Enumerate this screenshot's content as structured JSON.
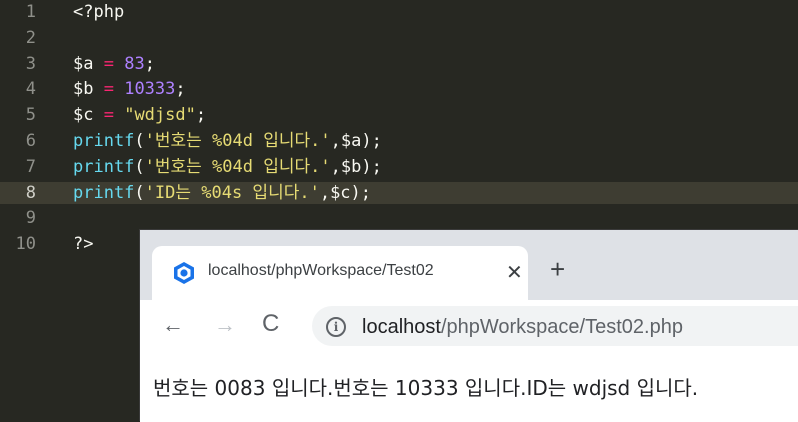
{
  "editor": {
    "lines": [
      {
        "num": "1",
        "parts": [
          {
            "t": "<?php",
            "c": "plain"
          }
        ]
      },
      {
        "num": "2",
        "parts": []
      },
      {
        "num": "3",
        "parts": [
          {
            "t": "$a",
            "c": "plain"
          },
          {
            "t": " = ",
            "c": "op"
          },
          {
            "t": "83",
            "c": "num"
          },
          {
            "t": ";",
            "c": "plain"
          }
        ]
      },
      {
        "num": "4",
        "parts": [
          {
            "t": "$b",
            "c": "plain"
          },
          {
            "t": " = ",
            "c": "op"
          },
          {
            "t": "10333",
            "c": "num"
          },
          {
            "t": ";",
            "c": "plain"
          }
        ]
      },
      {
        "num": "5",
        "parts": [
          {
            "t": "$c",
            "c": "plain"
          },
          {
            "t": " = ",
            "c": "op"
          },
          {
            "t": "\"wdjsd\"",
            "c": "str"
          },
          {
            "t": ";",
            "c": "plain"
          }
        ]
      },
      {
        "num": "6",
        "parts": [
          {
            "t": "printf",
            "c": "fn"
          },
          {
            "t": "(",
            "c": "plain"
          },
          {
            "t": "'번호는 %04d 입니다.'",
            "c": "str"
          },
          {
            "t": ",$a);",
            "c": "plain"
          }
        ]
      },
      {
        "num": "7",
        "parts": [
          {
            "t": "printf",
            "c": "fn"
          },
          {
            "t": "(",
            "c": "plain"
          },
          {
            "t": "'번호는 %04d 입니다.'",
            "c": "str"
          },
          {
            "t": ",$b);",
            "c": "plain"
          }
        ]
      },
      {
        "num": "8",
        "parts": [
          {
            "t": "printf",
            "c": "fn"
          },
          {
            "t": "(",
            "c": "plain"
          },
          {
            "t": "'ID는 %04s 입니다.'",
            "c": "str"
          },
          {
            "t": ",$c);",
            "c": "plain"
          }
        ]
      },
      {
        "num": "9",
        "parts": []
      },
      {
        "num": "10",
        "parts": [
          {
            "t": "?>",
            "c": "plain"
          }
        ]
      }
    ],
    "active_line": "8"
  },
  "browser": {
    "tab_title": "localhost/phpWorkspace/Test02",
    "tab_close_glyph": "✕",
    "new_tab_glyph": "+",
    "nav_back_glyph": "←",
    "nav_forward_glyph": "→",
    "reload_glyph": "C",
    "info_glyph": "i",
    "url_host": "localhost",
    "url_path": "/phpWorkspace/Test02.php",
    "page_output": "번호는 0083 입니다.번호는 10333 입니다.ID는 wdjsd 입니다."
  },
  "icons": {
    "favicon": "php-server-icon",
    "back": "arrow-left-icon",
    "forward": "arrow-right-icon",
    "reload": "reload-icon",
    "info": "info-icon",
    "close": "close-icon",
    "new_tab": "plus-icon"
  },
  "colors": {
    "editor_bg": "#272822",
    "keyword_fn": "#66d9ef",
    "operator": "#f92672",
    "number": "#ae81ff",
    "string": "#e6db74",
    "favicon_blue": "#1a73e8"
  }
}
